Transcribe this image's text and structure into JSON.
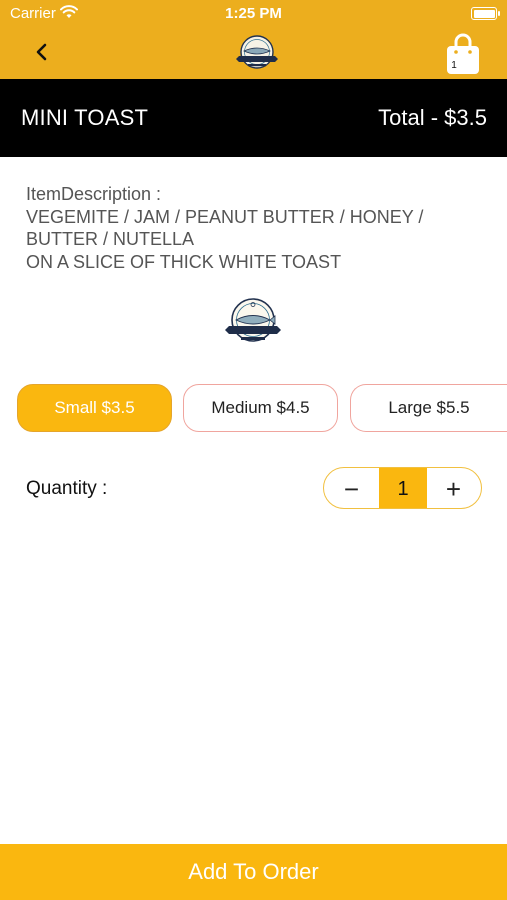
{
  "status_bar": {
    "carrier": "Carrier",
    "time": "1:25 PM"
  },
  "nav": {
    "cart_count": "1"
  },
  "product": {
    "name": "MINI TOAST",
    "total": "Total - $3.5",
    "description_label": "ItemDescription :",
    "description_lines": [
      "VEGEMITE / JAM / PEANUT BUTTER / HONEY /",
      "BUTTER / NUTELLA",
      "ON A SLICE OF THICK WHITE TOAST"
    ]
  },
  "sizes": [
    {
      "label": "Small $3.5",
      "selected": true
    },
    {
      "label": "Medium $4.5",
      "selected": false
    },
    {
      "label": "Large $5.5",
      "selected": false
    }
  ],
  "quantity": {
    "label": "Quantity :",
    "value": "1",
    "minus_symbol": "−",
    "plus_symbol": "+"
  },
  "cta": {
    "label": "Add To Order"
  },
  "colors": {
    "nav_yellow": "#ECAE1E",
    "accent": "#FAB70F",
    "title_bar": "#000000",
    "unselected_border": "#F0A59E"
  },
  "icons": {
    "back": "chevron-left-icon",
    "cart": "shopping-bag-icon",
    "wifi": "wifi-icon",
    "battery": "battery-icon",
    "logo": "fish-badge-logo"
  }
}
